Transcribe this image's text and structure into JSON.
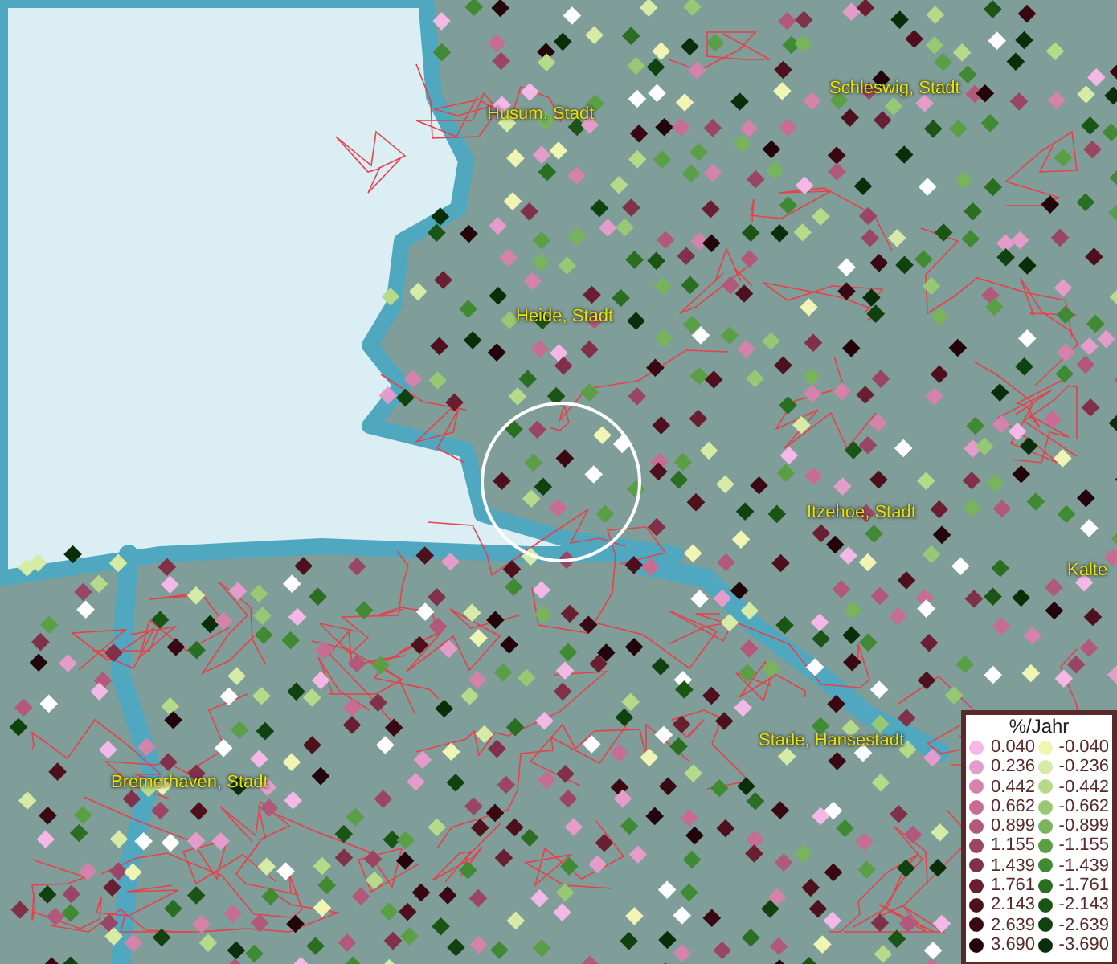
{
  "map": {
    "places": [
      {
        "name": "Husum, Stadt"
      },
      {
        "name": "Schleswig, Stadt"
      },
      {
        "name": "Heide, Stadt"
      },
      {
        "name": "Itzehoe, Stadt"
      },
      {
        "name": "Kalte"
      },
      {
        "name": "Stade, Hansestadt"
      },
      {
        "name": "Bremerhaven, Stadt"
      }
    ]
  },
  "legend": {
    "title": "%/Jahr",
    "rows": [
      {
        "increase": {
          "value": "0.040",
          "color": "#f4b8e6"
        },
        "decrease": {
          "value": "-0.040",
          "color": "#f0f5b4"
        }
      },
      {
        "increase": {
          "value": "0.236",
          "color": "#e69ccb"
        },
        "decrease": {
          "value": "-0.236",
          "color": "#d5eba6"
        }
      },
      {
        "increase": {
          "value": "0.442",
          "color": "#d683ac"
        },
        "decrease": {
          "value": "-0.442",
          "color": "#b6da8a"
        }
      },
      {
        "increase": {
          "value": "0.662",
          "color": "#c76d93"
        },
        "decrease": {
          "value": "-0.662",
          "color": "#97c873"
        }
      },
      {
        "increase": {
          "value": "0.899",
          "color": "#b2587a"
        },
        "decrease": {
          "value": "-0.899",
          "color": "#78b45c"
        }
      },
      {
        "increase": {
          "value": "1.155",
          "color": "#9b4565"
        },
        "decrease": {
          "value": "-1.155",
          "color": "#5a9e45"
        }
      },
      {
        "increase": {
          "value": "1.439",
          "color": "#803049"
        },
        "decrease": {
          "value": "-1.439",
          "color": "#3f8a32"
        }
      },
      {
        "increase": {
          "value": "1.761",
          "color": "#6a1e31"
        },
        "decrease": {
          "value": "-1.761",
          "color": "#2a6e22"
        }
      },
      {
        "increase": {
          "value": "2.143",
          "color": "#4f101d"
        },
        "decrease": {
          "value": "-2.143",
          "color": "#1b5516"
        }
      },
      {
        "increase": {
          "value": "2.639",
          "color": "#3a0812"
        },
        "decrease": {
          "value": "-2.639",
          "color": "#0f420e"
        }
      },
      {
        "increase": {
          "value": "3.690",
          "color": "#22040a"
        },
        "decrease": {
          "value": "-3.690",
          "color": "#0a2e0a"
        }
      }
    ]
  }
}
